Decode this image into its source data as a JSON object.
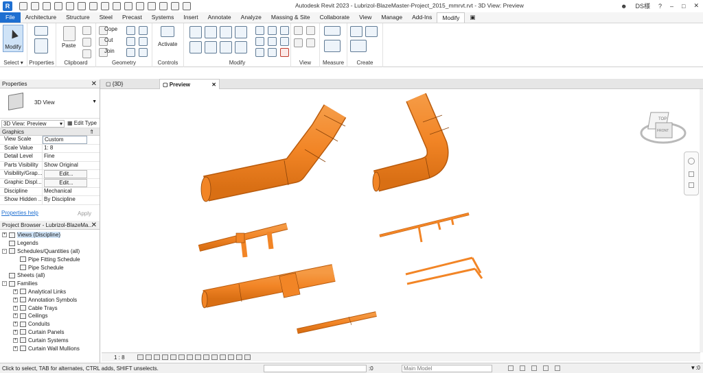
{
  "window": {
    "title": "Autodesk Revit 2023 - Lubrizol-BlazeMaster-Project_2015_mmrvt.rvt - 3D View: Preview",
    "user": "DS様",
    "app_logo": "R"
  },
  "ribbon_tabs": [
    "File",
    "Architecture",
    "Structure",
    "Steel",
    "Precast",
    "Systems",
    "Insert",
    "Annotate",
    "Analyze",
    "Massing & Site",
    "Collaborate",
    "View",
    "Manage",
    "Add-Ins",
    "Modify"
  ],
  "active_tab": "Modify",
  "ribbon": {
    "modify_label": "Modify",
    "select_label": "Select",
    "properties_label": "Properties",
    "paste_label": "Paste",
    "clipboard_label": "Clipboard",
    "cope_label": "Cope",
    "cut_label": "Cut",
    "join_label": "Join",
    "geometry_label": "Geometry",
    "activate_label": "Activate",
    "controls_label": "Controls",
    "modify_panel_label": "Modify",
    "view_label": "View",
    "measure_label": "Measure",
    "create_label": "Create"
  },
  "properties": {
    "header": "Properties",
    "type_name": "3D View",
    "instance_selector": "3D View: Preview",
    "edit_type": "Edit Type",
    "group": "Graphics",
    "rows": [
      {
        "key": "View Scale",
        "value": "Custom",
        "style": "box"
      },
      {
        "key": "Scale Value",
        "value": "1:  8",
        "style": "plain"
      },
      {
        "key": "Detail Level",
        "value": "Fine",
        "style": "plain"
      },
      {
        "key": "Parts Visibility",
        "value": "Show Original",
        "style": "plain"
      },
      {
        "key": "Visibility/Grap...",
        "value": "Edit...",
        "style": "btn"
      },
      {
        "key": "Graphic Displ...",
        "value": "Edit...",
        "style": "btn"
      },
      {
        "key": "Discipline",
        "value": "Mechanical",
        "style": "plain"
      },
      {
        "key": "Show Hidden ...",
        "value": "By Discipline",
        "style": "plain"
      }
    ],
    "help_link": "Properties help",
    "apply_label": "Apply"
  },
  "browser": {
    "header": "Project Browser - Lubrizol-BlazeMa...",
    "items": [
      {
        "label": "Views (Discipline)",
        "depth": 0,
        "toggle": "+",
        "selected": true
      },
      {
        "label": "Legends",
        "depth": 0,
        "toggle": "",
        "selected": false
      },
      {
        "label": "Schedules/Quantities (all)",
        "depth": 0,
        "toggle": "-",
        "selected": false
      },
      {
        "label": "Pipe Fitting Schedule",
        "depth": 1,
        "toggle": "",
        "selected": false
      },
      {
        "label": "Pipe Schedule",
        "depth": 1,
        "toggle": "",
        "selected": false
      },
      {
        "label": "Sheets (all)",
        "depth": 0,
        "toggle": "",
        "selected": false
      },
      {
        "label": "Families",
        "depth": 0,
        "toggle": "-",
        "selected": false
      },
      {
        "label": "Analytical Links",
        "depth": 1,
        "toggle": "+",
        "selected": false
      },
      {
        "label": "Annotation Symbols",
        "depth": 1,
        "toggle": "+",
        "selected": false
      },
      {
        "label": "Cable Trays",
        "depth": 1,
        "toggle": "+",
        "selected": false
      },
      {
        "label": "Ceilings",
        "depth": 1,
        "toggle": "+",
        "selected": false
      },
      {
        "label": "Conduits",
        "depth": 1,
        "toggle": "+",
        "selected": false
      },
      {
        "label": "Curtain Panels",
        "depth": 1,
        "toggle": "+",
        "selected": false
      },
      {
        "label": "Curtain Systems",
        "depth": 1,
        "toggle": "+",
        "selected": false
      },
      {
        "label": "Curtain Wall Mullions",
        "depth": 1,
        "toggle": "+",
        "selected": false
      }
    ]
  },
  "view_tabs": [
    {
      "label": "{3D}",
      "active": false
    },
    {
      "label": "Preview",
      "active": true
    }
  ],
  "view_cube": {
    "top": "TOP",
    "front": "FRONT"
  },
  "colors": {
    "pipe": "#f28526",
    "pipe_dark": "#c9610f",
    "accent": "#1e6fd1"
  },
  "view_bar": {
    "scale": "1 : 8"
  },
  "status": {
    "message": "Click to select, TAB for alternates, CTRL adds, SHIFT unselects.",
    "zero": ":0",
    "model": "Main Model"
  }
}
